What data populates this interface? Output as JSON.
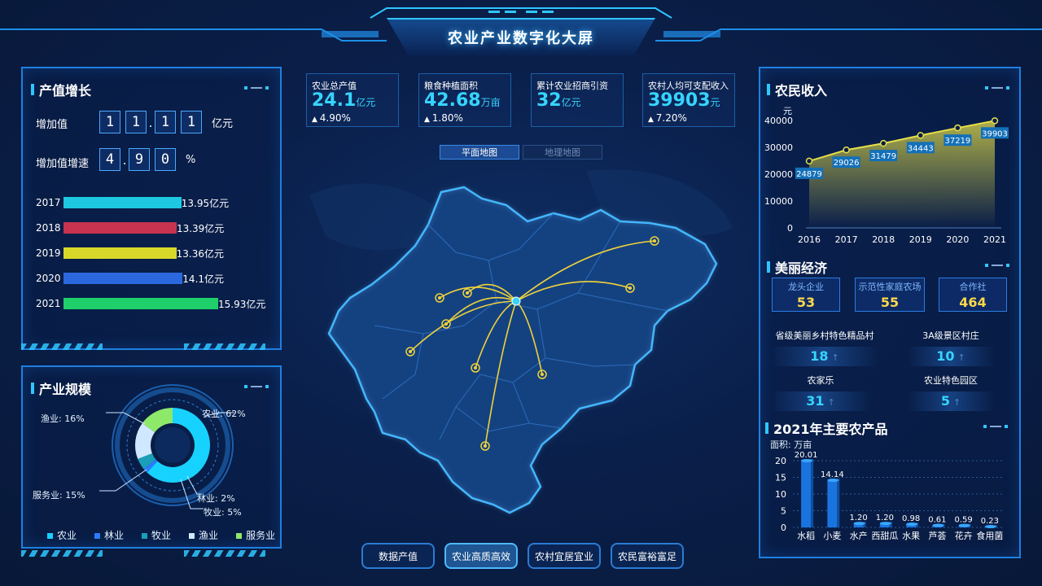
{
  "header": {
    "title": "农业产业数字化大屏"
  },
  "growth": {
    "title": "产值增长",
    "added_value_label": "增加值",
    "added_value_digits": [
      "1",
      "1",
      "1",
      "1"
    ],
    "added_value_unit": "亿元",
    "rate_label": "增加值增速",
    "rate_digits": [
      "4",
      "9",
      "0"
    ],
    "rate_unit": "%"
  },
  "scale": {
    "title": "产业规模",
    "legend": [
      "农业",
      "林业",
      "牧业",
      "渔业",
      "服务业"
    ],
    "legend_colors": [
      "#17d2ff",
      "#2a7cff",
      "#1a9fb8",
      "#cfe8ff",
      "#8ee86a"
    ],
    "labels": {
      "agri": "农业:  62%",
      "fishery": "渔业:  16%",
      "service": "服务业:  15%",
      "forestry": "林业:  2%",
      "livestock": "牧业:  5%"
    }
  },
  "kpis": [
    {
      "label": "农业总产值",
      "value": "24.1",
      "unit": "亿元",
      "change": "4.90%"
    },
    {
      "label": "粮食种植面积",
      "value": "42.68",
      "unit": "万亩",
      "change": "1.80%"
    },
    {
      "label": "累计农业招商引资",
      "value": "32",
      "unit": "亿元",
      "change": ""
    },
    {
      "label": "农村人均可支配收入",
      "value": "39903",
      "unit": "元",
      "change": "7.20%"
    }
  ],
  "map_tabs": {
    "flat": "平面地图",
    "geo": "地理地图"
  },
  "nav": [
    "数据产值",
    "农业高质高效",
    "农村宜居宜业",
    "农民富裕富足"
  ],
  "income": {
    "title": "农民收入",
    "y_unit": "元"
  },
  "beauty": {
    "title": "美丽经济",
    "cards": [
      {
        "label": "龙头企业",
        "value": "53"
      },
      {
        "label": "示范性家庭农场",
        "value": "55"
      },
      {
        "label": "合作社",
        "value": "464"
      }
    ],
    "stats": [
      {
        "label": "省级美丽乡村特色精品村",
        "value": "18"
      },
      {
        "label": "3A级景区村庄",
        "value": "10"
      },
      {
        "label": "农家乐",
        "value": "31"
      },
      {
        "label": "农业特色园区",
        "value": "5"
      }
    ]
  },
  "products": {
    "title": "2021年主要农产品",
    "y_unit": "面积:  万亩"
  },
  "chart_data": [
    {
      "type": "bar",
      "orientation": "horizontal",
      "categories": [
        "2017",
        "2018",
        "2019",
        "2020",
        "2021"
      ],
      "values": [
        13.95,
        13.39,
        13.36,
        14.1,
        15.93
      ],
      "value_labels": [
        "13.95亿元",
        "13.39亿元",
        "13.36亿元",
        "14.1亿元",
        "15.93亿元"
      ],
      "colors": [
        "#1ec8e0",
        "#c8334f",
        "#d8d82a",
        "#2b68dd",
        "#1fcf6a"
      ]
    },
    {
      "type": "pie",
      "categories": [
        "农业",
        "林业",
        "牧业",
        "渔业",
        "服务业"
      ],
      "values": [
        62,
        2,
        5,
        16,
        15
      ]
    },
    {
      "type": "area",
      "x": [
        "2016",
        "2017",
        "2018",
        "2019",
        "2020",
        "2021"
      ],
      "values": [
        24879,
        29026,
        31479,
        34443,
        37219,
        39903
      ],
      "ylim": [
        0,
        40000
      ],
      "yticks": [
        0,
        10000,
        20000,
        30000,
        40000
      ],
      "ylabel": "元"
    },
    {
      "type": "bar",
      "categories": [
        "水稻",
        "小麦",
        "水产",
        "西甜瓜",
        "水果",
        "芦荟",
        "花卉",
        "食用菌"
      ],
      "values": [
        20.01,
        14.14,
        1.2,
        1.2,
        0.98,
        0.61,
        0.59,
        0.23
      ],
      "value_labels": [
        "20.01",
        "14.14",
        "1.20",
        "1.20",
        "0.98",
        "0.61",
        "0.59",
        "0.23"
      ],
      "ylim": [
        0,
        20
      ],
      "yticks": [
        0,
        5,
        10,
        15,
        20
      ],
      "ylabel": "面积:  万亩"
    }
  ]
}
